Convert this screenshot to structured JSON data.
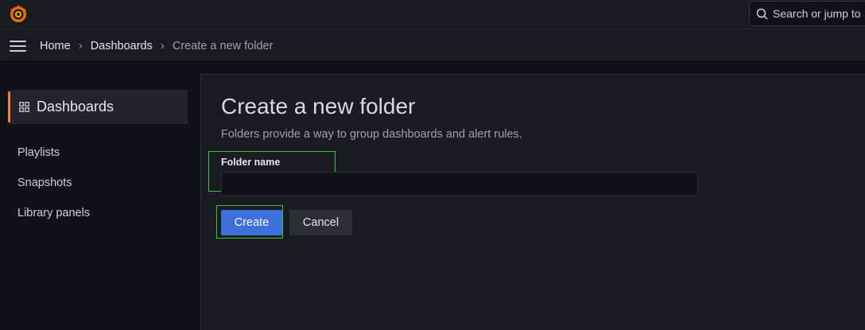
{
  "topbar": {
    "logo_icon": "grafana-logo-icon",
    "search_label": "Search or jump to"
  },
  "breadcrumb": {
    "menu_icon": "hamburger-menu-icon",
    "items": [
      {
        "label": "Home"
      },
      {
        "label": "Dashboards"
      }
    ],
    "current": "Create a new folder",
    "separator": "›"
  },
  "sidebar": {
    "active": {
      "label": "Dashboards",
      "icon": "apps-grid-icon",
      "accent": "#ff7a3d"
    },
    "items": [
      {
        "label": "Playlists"
      },
      {
        "label": "Snapshots"
      },
      {
        "label": "Library panels"
      }
    ]
  },
  "main": {
    "title": "Create a new folder",
    "subtitle": "Folders provide a way to group dashboards and alert rules.",
    "folder_name_label": "Folder name",
    "folder_name_value": "",
    "create_label": "Create",
    "cancel_label": "Cancel"
  },
  "colors": {
    "primary": "#3d71d9",
    "background": "#111217",
    "panel": "#181b1f"
  }
}
